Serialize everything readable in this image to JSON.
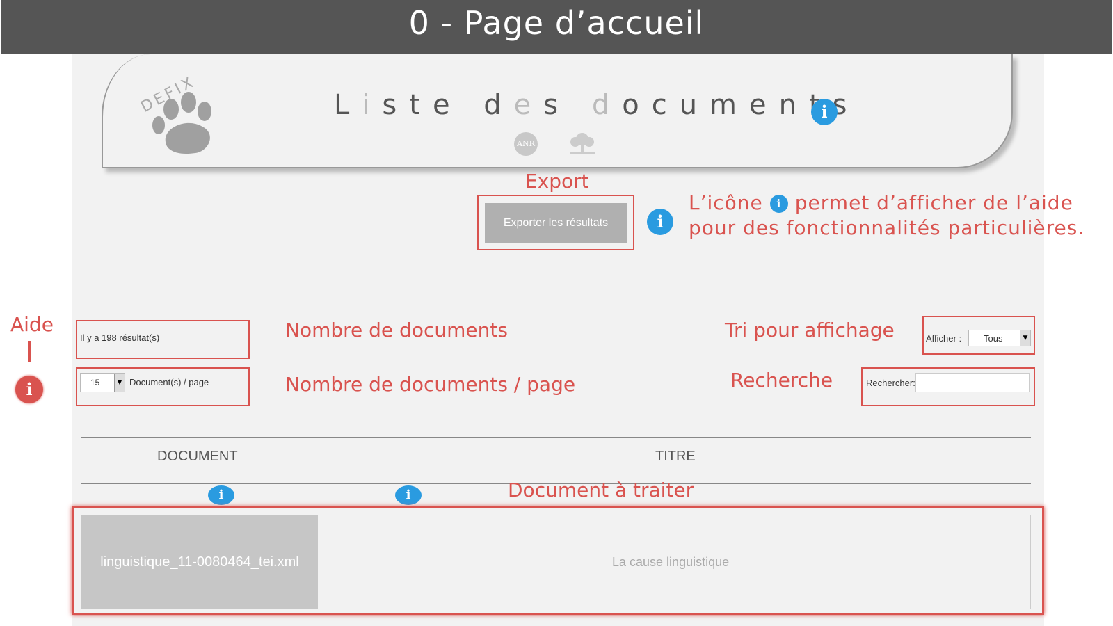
{
  "banner": {
    "title": "0 - Page d’accueil"
  },
  "header": {
    "logo_text": "DEFIX",
    "title_parts": [
      {
        "t": "L",
        "dim": false
      },
      {
        "t": "i",
        "dim": true
      },
      {
        "t": "ste ",
        "dim": false
      },
      {
        "t": "d",
        "dim": false
      },
      {
        "t": "e",
        "dim": true
      },
      {
        "t": "s ",
        "dim": false
      },
      {
        "t": "d",
        "dim": true
      },
      {
        "t": "ocuments",
        "dim": false
      }
    ],
    "title": "Liste des documents",
    "anr_logo": "ANR"
  },
  "export": {
    "annotation": "Export",
    "button_label": "Exporter les résultats"
  },
  "help": {
    "line1_before": "L’icône",
    "line1_after": "permet d’afficher de l’aide",
    "line2": "pour des fonctionnalités particulières.",
    "aide_label": "Aide"
  },
  "controls": {
    "results_text": "Il y a 198 résultat(s)",
    "results_annotation": "Nombre  de documents",
    "perpage_value": "15",
    "perpage_label": "Document(s) / page",
    "perpage_annotation": "Nombre de documents / page",
    "sort_annotation": "Tri pour affichage",
    "sort_label": "Afficher :",
    "sort_value": "Tous",
    "search_annotation": "Recherche",
    "search_label": "Rechercher:",
    "search_value": ""
  },
  "table": {
    "headers": [
      "DOCUMENT",
      "TITRE"
    ],
    "annotation": "Document à traiter",
    "rows": [
      {
        "document": "linguistique_11-0080464_tei.xml",
        "titre": "La cause linguistique"
      }
    ]
  },
  "colors": {
    "annotation_red": "#d9534f",
    "info_blue": "#2a9be0",
    "banner": "#555555"
  },
  "icons": {
    "info": "info-icon",
    "paw": "paw-icon",
    "dropdown": "chevron-down-icon"
  }
}
